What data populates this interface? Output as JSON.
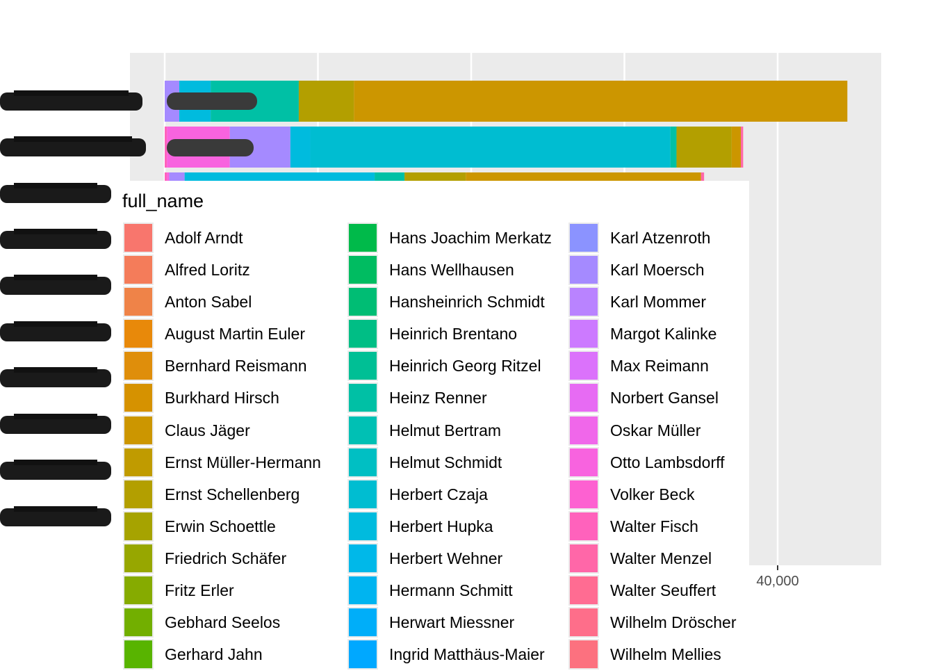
{
  "chart_data": {
    "type": "bar",
    "orientation": "horizontal",
    "stacked": true,
    "xlim": [
      -1000,
      47000
    ],
    "x_ticks": [
      0,
      10000,
      20000,
      30000,
      40000
    ],
    "x_tick_labels_visible": [
      "40,000"
    ],
    "grid": true,
    "legend": {
      "title": "full_name",
      "placement": "overlay-bottom-left",
      "entries": [
        {
          "name": "Adolf Arndt",
          "color": "#F8766D"
        },
        {
          "name": "Alfred Loritz",
          "color": "#F47C5A"
        },
        {
          "name": "Anton Sabel",
          "color": "#EF8348"
        },
        {
          "name": "August Martin Euler",
          "color": "#E8890A"
        },
        {
          "name": "Bernhard Reismann",
          "color": "#DF8E0B"
        },
        {
          "name": "Burkhard Hirsch",
          "color": "#D69200"
        },
        {
          "name": "Claus Jäger",
          "color": "#CC9600"
        },
        {
          "name": "Ernst Müller-Hermann",
          "color": "#C09B00"
        },
        {
          "name": "Ernst Schellenberg",
          "color": "#B39F00"
        },
        {
          "name": "Erwin Schoettle",
          "color": "#A6A300"
        },
        {
          "name": "Friedrich Schäfer",
          "color": "#97A700"
        },
        {
          "name": "Fritz Erler",
          "color": "#86AB00"
        },
        {
          "name": "Gebhard Seelos",
          "color": "#72AF00"
        },
        {
          "name": "Gerhard Jahn",
          "color": "#58B400"
        },
        {
          "name": "Hans Joachim Merkatz",
          "color": "#00BA4A"
        },
        {
          "name": "Hans Wellhausen",
          "color": "#00BC61"
        },
        {
          "name": "Hansheinrich Schmidt",
          "color": "#00BD74"
        },
        {
          "name": "Heinrich Brentano",
          "color": "#00BE85"
        },
        {
          "name": "Heinrich Georg Ritzel",
          "color": "#00BF95"
        },
        {
          "name": "Heinz Renner",
          "color": "#00C0A5"
        },
        {
          "name": "Helmut Bertram",
          "color": "#00C0B4"
        },
        {
          "name": "Helmut Schmidt",
          "color": "#00BFC3"
        },
        {
          "name": "Herbert Czaja",
          "color": "#00BDD1"
        },
        {
          "name": "Herbert Hupka",
          "color": "#00BBDE"
        },
        {
          "name": "Herbert Wehner",
          "color": "#00B8E9"
        },
        {
          "name": "Hermann Schmitt",
          "color": "#00B4F0"
        },
        {
          "name": "Herwart Miessner",
          "color": "#00AEF9"
        },
        {
          "name": "Ingrid Matthäus-Maier",
          "color": "#00A8FF"
        },
        {
          "name": "Karl Atzenroth",
          "color": "#8B93FF"
        },
        {
          "name": "Karl Moersch",
          "color": "#A58AFF"
        },
        {
          "name": "Karl Mommer",
          "color": "#B983FF"
        },
        {
          "name": "Margot Kalinke",
          "color": "#CC7AFF"
        },
        {
          "name": "Max Reimann",
          "color": "#DB72FB"
        },
        {
          "name": "Norbert Gansel",
          "color": "#E76BF3"
        },
        {
          "name": "Oskar Müller",
          "color": "#F067EA"
        },
        {
          "name": "Otto Lambsdorff",
          "color": "#F863DF"
        },
        {
          "name": "Volker Beck",
          "color": "#FD61D1"
        },
        {
          "name": "Walter Fisch",
          "color": "#FF62BC"
        },
        {
          "name": "Walter Menzel",
          "color": "#FF67A8"
        },
        {
          "name": "Walter Seuffert",
          "color": "#FF6C92"
        },
        {
          "name": "Wilhelm Dröscher",
          "color": "#FE6E8A"
        },
        {
          "name": "Wilhelm Mellies",
          "color": "#FC717F"
        }
      ]
    },
    "bars": [
      {
        "segments": [
          {
            "name": "Karl Moersch",
            "value": 950
          },
          {
            "name": "Herbert Hupka",
            "value": 2050
          },
          {
            "name": "Heinz Renner",
            "value": 5750
          },
          {
            "name": "Ernst Schellenberg",
            "value": 3600
          },
          {
            "name": "Claus Jäger",
            "value": 32200
          }
        ]
      },
      {
        "segments": [
          {
            "name": "Walter Fisch",
            "value": 150
          },
          {
            "name": "Otto Lambsdorff",
            "value": 4100
          },
          {
            "name": "Karl Moersch",
            "value": 3950
          },
          {
            "name": "Herbert Hupka",
            "value": 1300
          },
          {
            "name": "Herbert Czaja",
            "value": 23500
          },
          {
            "name": "Heinz Renner",
            "value": 400
          },
          {
            "name": "Ernst Schellenberg",
            "value": 3600
          },
          {
            "name": "Claus Jäger",
            "value": 600
          },
          {
            "name": "Walter Menzel",
            "value": 150
          }
        ]
      },
      {
        "segments": [
          {
            "name": "Walter Fisch",
            "value": 150
          },
          {
            "name": "Otto Lambsdorff",
            "value": 150
          },
          {
            "name": "Karl Moersch",
            "value": 1000
          },
          {
            "name": "Herbert Hupka",
            "value": 12400
          },
          {
            "name": "Heinz Renner",
            "value": 1950
          },
          {
            "name": "Ernst Schellenberg",
            "value": 4000
          },
          {
            "name": "Claus Jäger",
            "value": 15350
          },
          {
            "name": "Walter Menzel",
            "value": 200
          }
        ]
      }
    ]
  }
}
